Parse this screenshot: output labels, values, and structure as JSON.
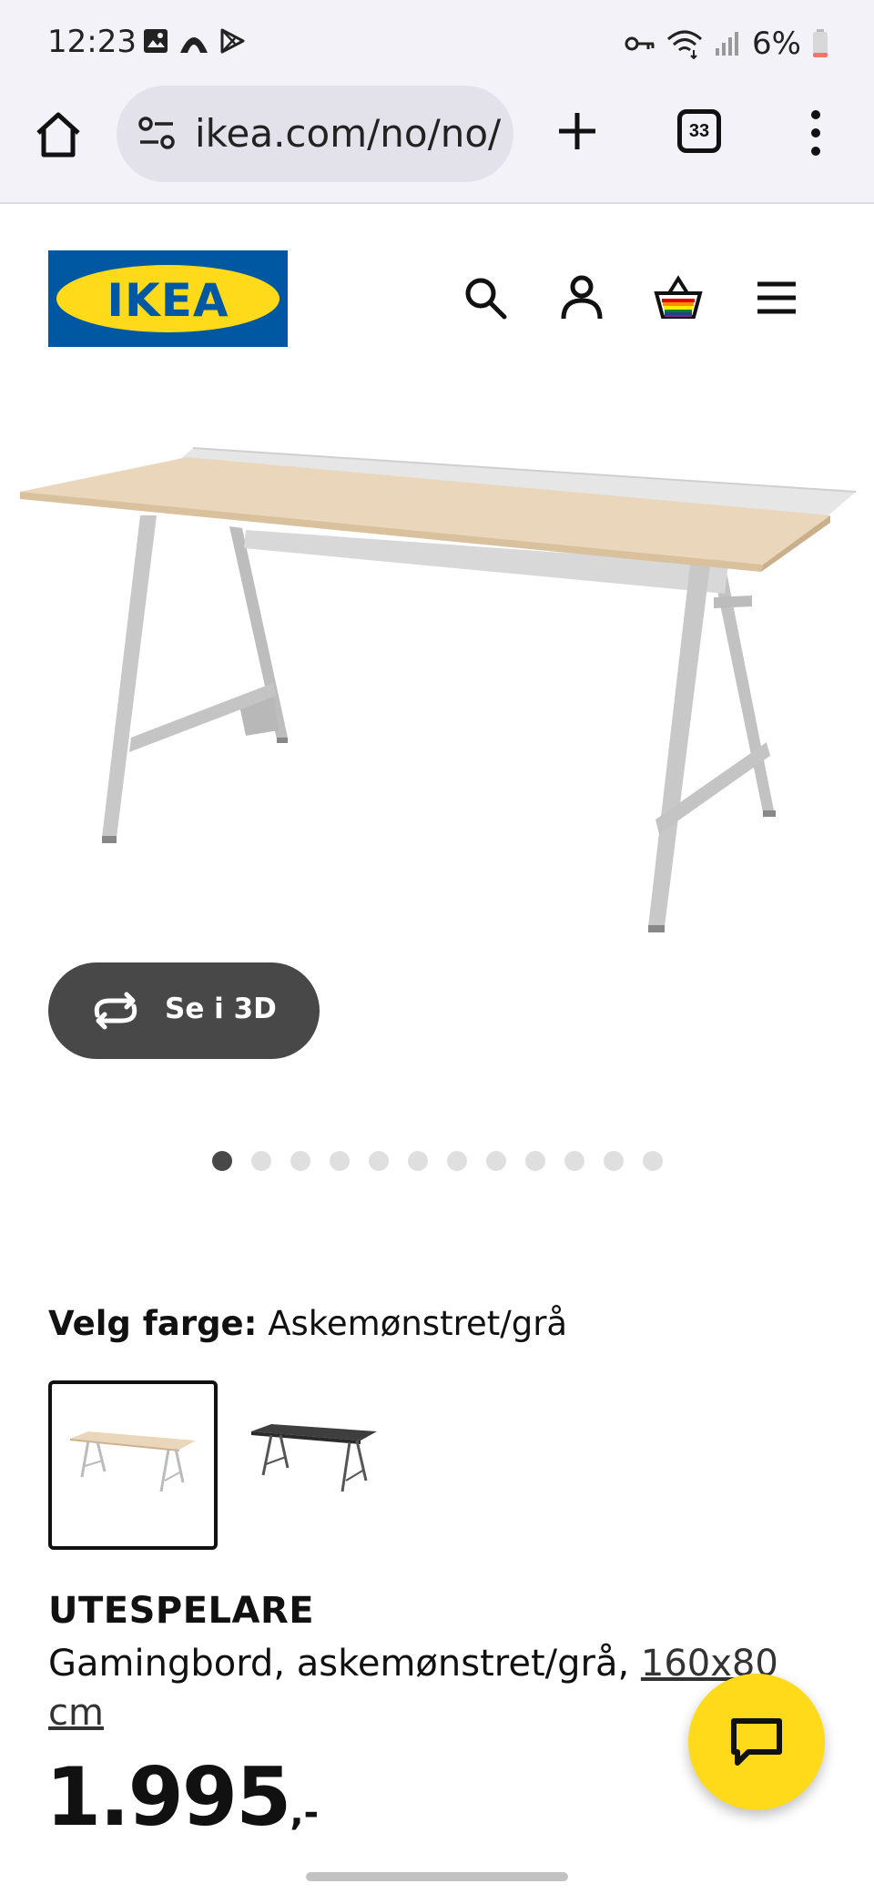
{
  "status_bar": {
    "time": "12:23",
    "battery": "6%"
  },
  "browser": {
    "url": "ikea.com/no/no/p",
    "tab_count": "33"
  },
  "brand": {
    "logo_text": "IKEA",
    "blue": "#0058a3",
    "yellow": "#ffda1a"
  },
  "header_icons": [
    "search-icon",
    "account-icon",
    "basket-icon",
    "menu-icon"
  ],
  "gallery": {
    "view_3d_label": "Se i 3D",
    "image_count": 12,
    "active_index": 0
  },
  "color_picker": {
    "label": "Velg farge:",
    "value": "Askemønstret/grå",
    "options": [
      "Askemønstret/grå",
      "Svart"
    ]
  },
  "product": {
    "name": "UTESPELARE",
    "description": "Gamingbord, askemønstret/grå,",
    "size": "160x80 cm",
    "price": "1.995",
    "price_suffix": ",-"
  }
}
